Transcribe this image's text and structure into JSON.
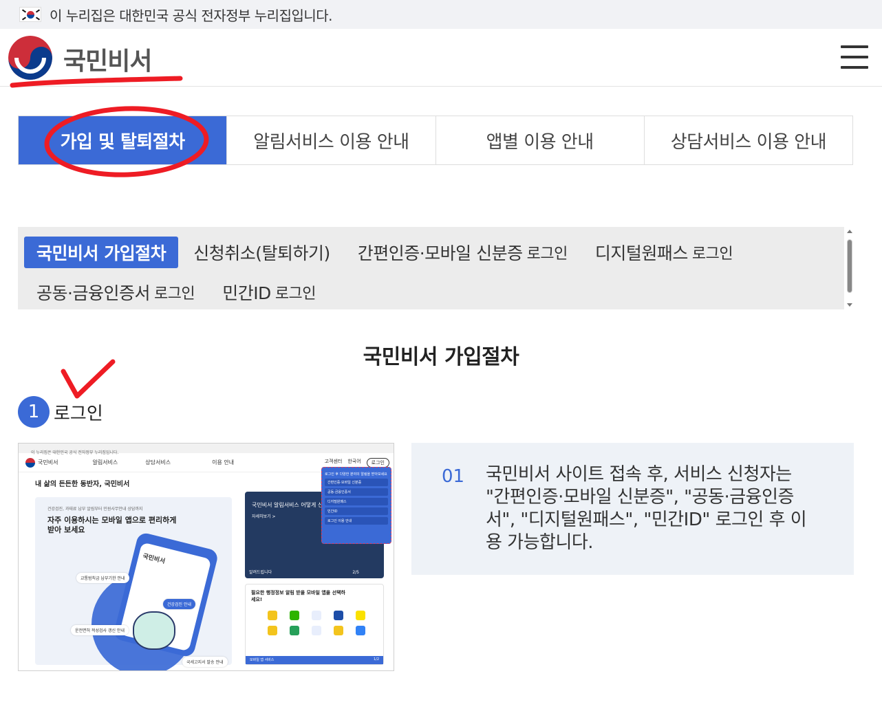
{
  "gov_banner": {
    "text": "이 누리집은 대한민국 공식 전자정부 누리집입니다."
  },
  "header": {
    "brand": "국민비서"
  },
  "main_tabs": [
    {
      "label": "가입 및 탈퇴절차",
      "active": true
    },
    {
      "label": "알림서비스 이용 안내"
    },
    {
      "label": "앱별 이용 안내"
    },
    {
      "label": "상담서비스 이용 안내"
    }
  ],
  "sub_tabs": [
    {
      "label": "국민비서 가입절차",
      "active": true
    },
    {
      "label": "신청취소(탈퇴하기)"
    },
    {
      "label": "간편인증·모바일 신분증",
      "suffix": "로그인"
    },
    {
      "label": "디지털원패스",
      "suffix": "로그인"
    },
    {
      "label": "공동·금융인증서",
      "suffix": "로그인"
    },
    {
      "label": "민간ID",
      "suffix": "로그인"
    }
  ],
  "section": {
    "title": "국민비서 가입절차",
    "step_number": "1",
    "step_label": "로그인"
  },
  "thumbnail": {
    "banner": "이 누리집은 대한민국 공식 전자정부 누리집입니다.",
    "brand": "국민비서",
    "nav": [
      "알림서비스",
      "상담서비스",
      "이용 안내"
    ],
    "right_links": [
      "고객센터",
      "한국어",
      "로그인"
    ],
    "tagline": "내 삶의 든든한 동반자, 국민비서",
    "card_small": "건강검진, 과태료 납부 알림부터 민원사무안내 상담까지",
    "card_big": "자주 이용하시는 모바일 앱으로 편리하게 받아 보세요",
    "phone_title": "국민비서",
    "chips": [
      "교통범칙금 납부기한 안내",
      "건강검진 안내",
      "운전면허 적성검사 갱신 안내",
      "국세고지서 발송 안내"
    ],
    "dark_title": "국민비서 알림서비스 어떻게 신청하는 건가요?",
    "dark_more": "자세히보기 >",
    "dark_foot": "알려드립니다",
    "dark_page": "2/5",
    "popup_title": "로그인 후 다양한 분야의 알림을 받아보세요",
    "popup_items": [
      "간편인증·모바일 신분증",
      "공동·금융인증서",
      "디지털원패스",
      "민간ID",
      "로그인 이용 안내"
    ],
    "apps_title": "필요한 행정정보 알림 받을 모바일 앱을 선택하세요!",
    "apps_bar": "모바일 앱 서비스",
    "apps_page": "1/2"
  },
  "description": {
    "number": "01",
    "text": "국민비서 사이트 접속 후, 서비스 신청자는 \"간편인증·모바일 신분증\", \"공동·금융인증서\", \"디지털원패스\", \"민간ID\" 로그인 후 이용 가능합니다."
  },
  "colors": {
    "accent": "#3b6ad6",
    "annotation": "#ee1c24"
  }
}
